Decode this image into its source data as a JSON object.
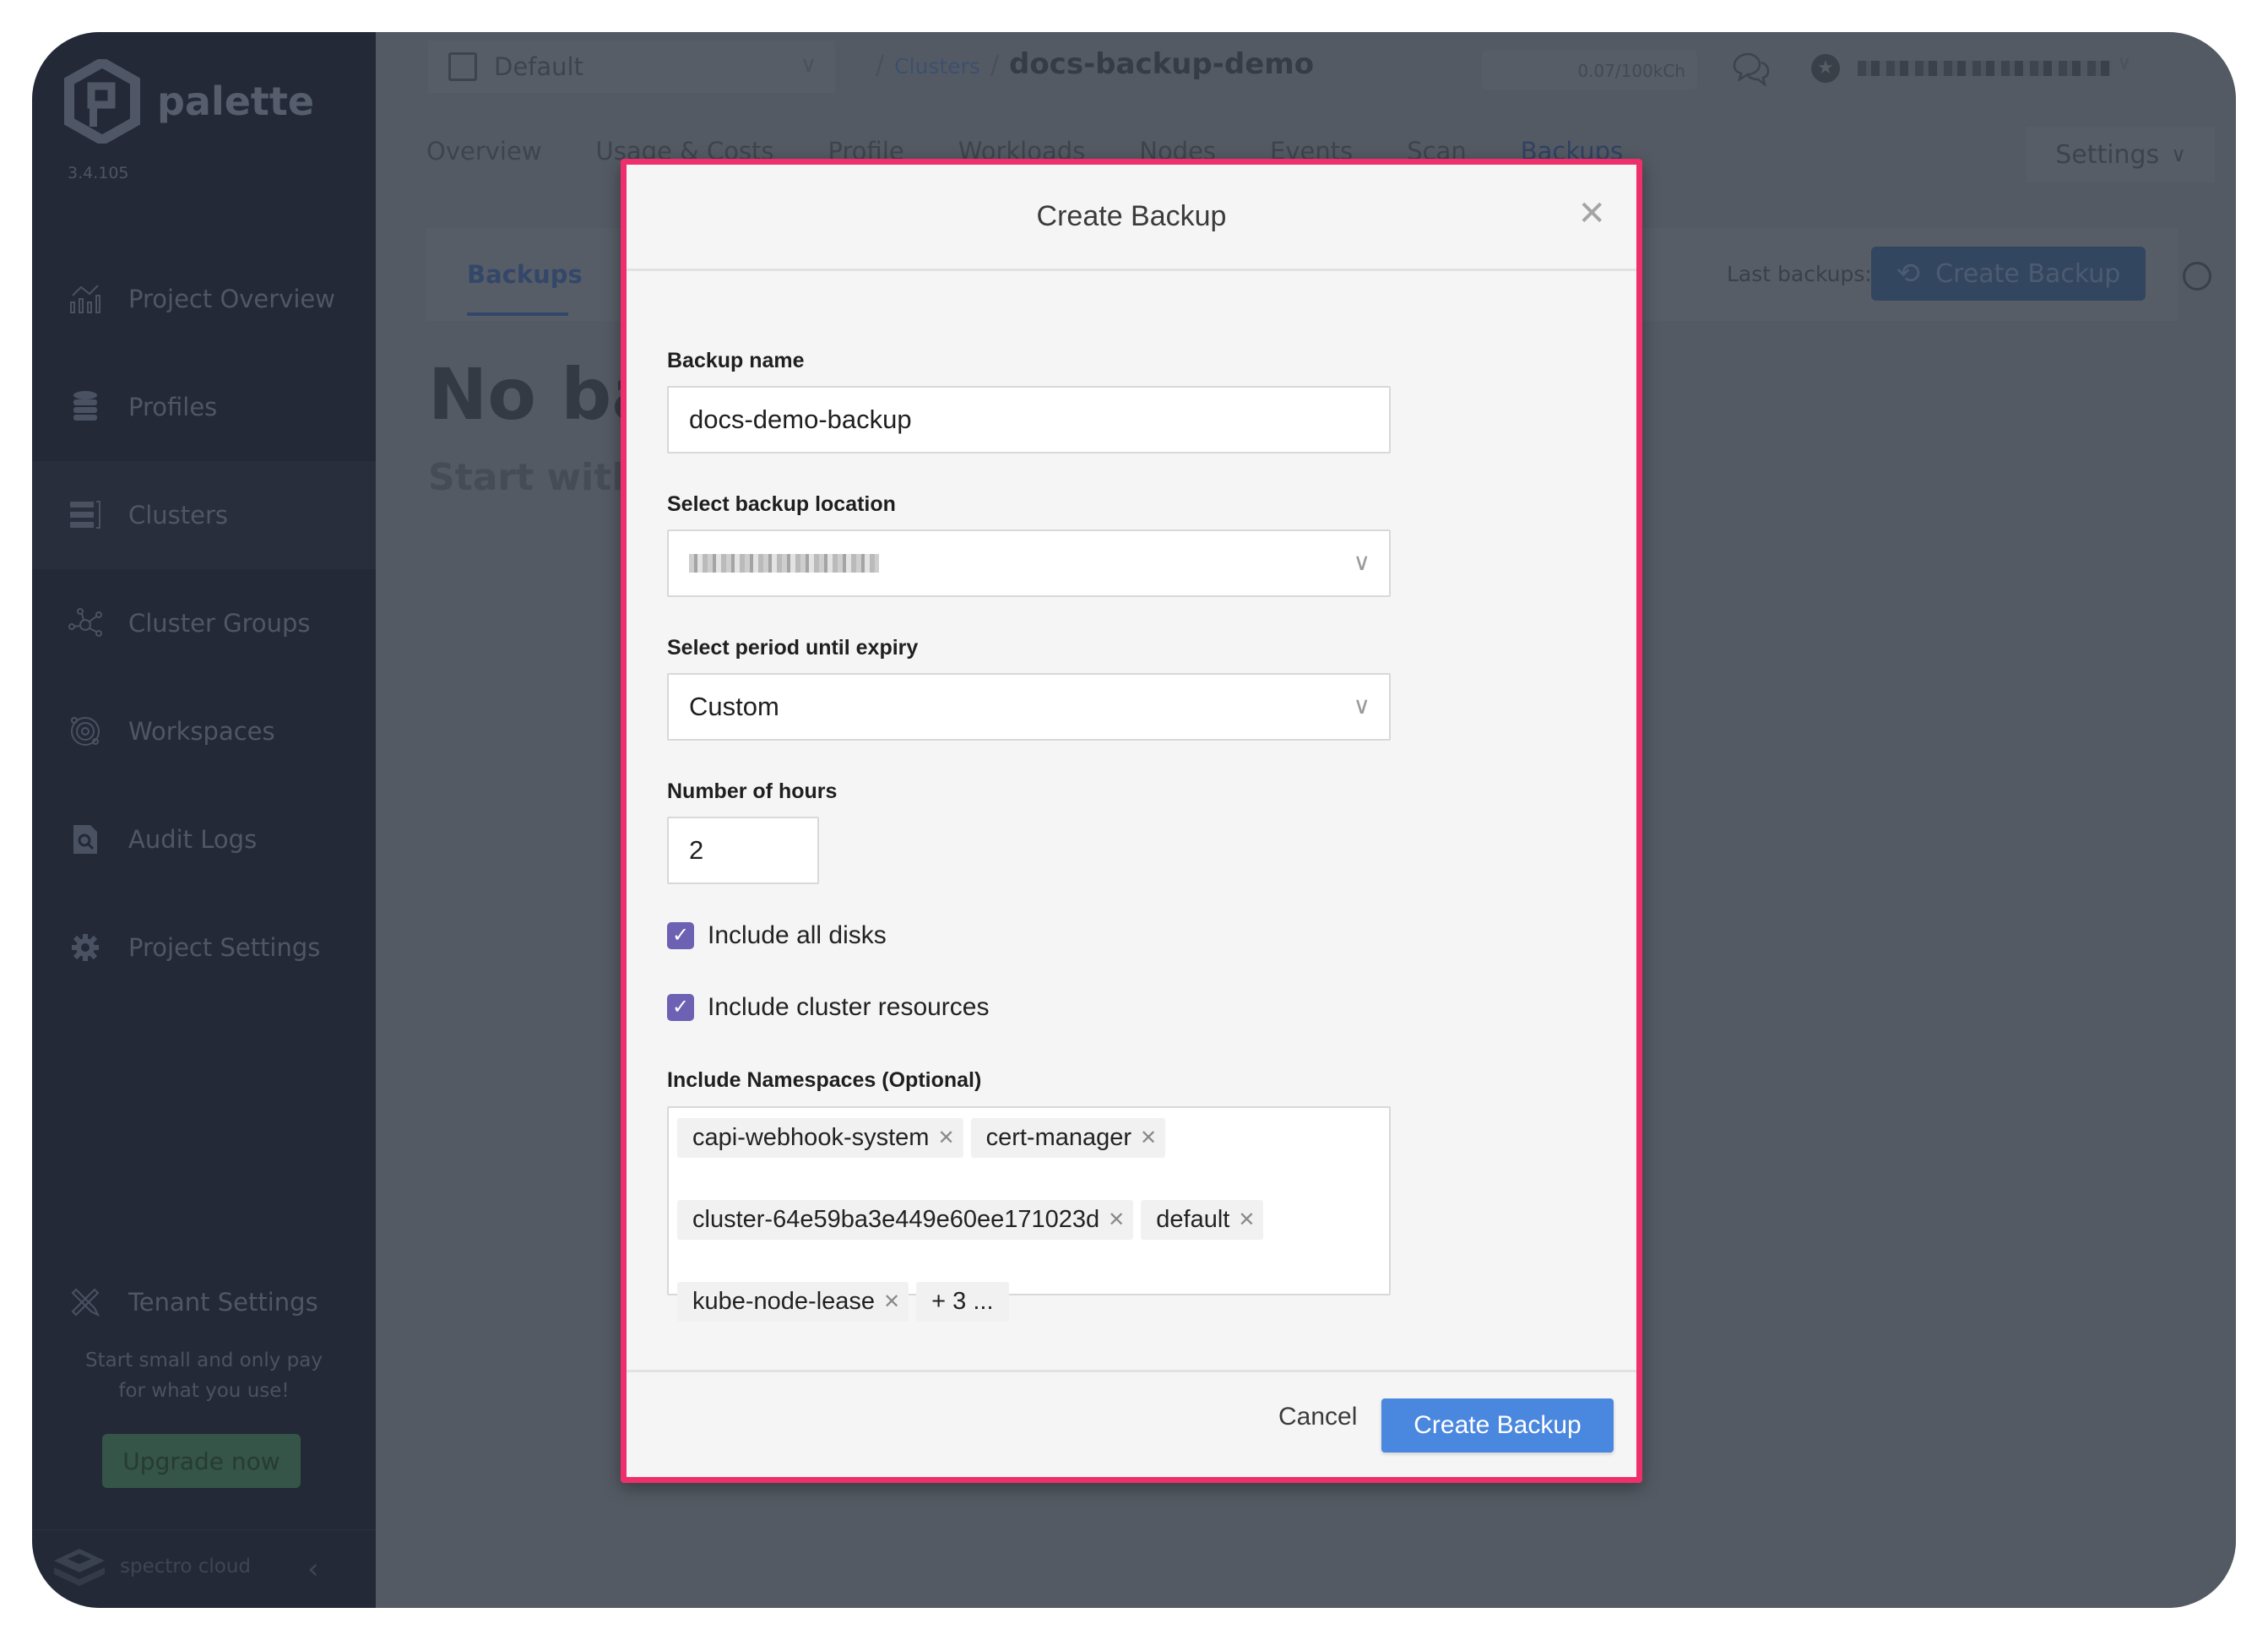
{
  "app": {
    "brand": "palette",
    "version": "3.4.105"
  },
  "sidebar": {
    "items": [
      {
        "label": "Project Overview",
        "icon": "chart-icon"
      },
      {
        "label": "Profiles",
        "icon": "database-stack-icon"
      },
      {
        "label": "Clusters",
        "icon": "server-rack-icon",
        "active": true
      },
      {
        "label": "Cluster Groups",
        "icon": "network-nodes-icon"
      },
      {
        "label": "Workspaces",
        "icon": "orbit-icon"
      },
      {
        "label": "Audit Logs",
        "icon": "file-search-icon"
      },
      {
        "label": "Project Settings",
        "icon": "gear-icon"
      }
    ],
    "tenant_settings": "Tenant Settings",
    "promo_line1": "Start small and only pay",
    "promo_line2": "for what you use!",
    "upgrade_label": "Upgrade now",
    "footer_brand": "spectro cloud",
    "collapse_glyph": "‹"
  },
  "header": {
    "project": "Default",
    "breadcrumb": {
      "parent": "Clusters",
      "current": "docs-backup-demo",
      "separator": "/"
    },
    "credits": "0.07/100kCh"
  },
  "tabs": [
    {
      "label": "Overview"
    },
    {
      "label": "Usage & Costs"
    },
    {
      "label": "Profile"
    },
    {
      "label": "Workloads"
    },
    {
      "label": "Nodes"
    },
    {
      "label": "Events"
    },
    {
      "label": "Scan"
    },
    {
      "label": "Backups",
      "active": true
    }
  ],
  "settings_label": "Settings",
  "backups_panel": {
    "subtab": "Backups",
    "last_backup": "Last backups: Never",
    "create_label": "Create Backup",
    "empty_title": "No backups",
    "empty_subtitle": "Start with creating a backup"
  },
  "modal": {
    "title": "Create Backup",
    "close_glyph": "✕",
    "backup_name": {
      "label": "Backup name",
      "value": "docs-demo-backup"
    },
    "location": {
      "label": "Select backup location"
    },
    "expiry": {
      "label": "Select period until expiry",
      "value": "Custom"
    },
    "hours": {
      "label": "Number of hours",
      "value": "2"
    },
    "include_disks": {
      "label": "Include all disks",
      "checked": true
    },
    "include_resources": {
      "label": "Include cluster resources",
      "checked": true
    },
    "namespaces": {
      "label": "Include Namespaces (Optional)",
      "chips": [
        "capi-webhook-system",
        "cert-manager",
        "cluster-64e59ba3e449e60ee171023d",
        "default",
        "kube-node-lease"
      ],
      "more": "+ 3 ..."
    },
    "cancel_label": "Cancel",
    "submit_label": "Create Backup"
  },
  "colors": {
    "highlight_border": "#ef2f6c",
    "primary_button": "#4a87de",
    "checkbox": "#6c61b3",
    "help_button": "#0057c8"
  },
  "help_glyph": "?"
}
